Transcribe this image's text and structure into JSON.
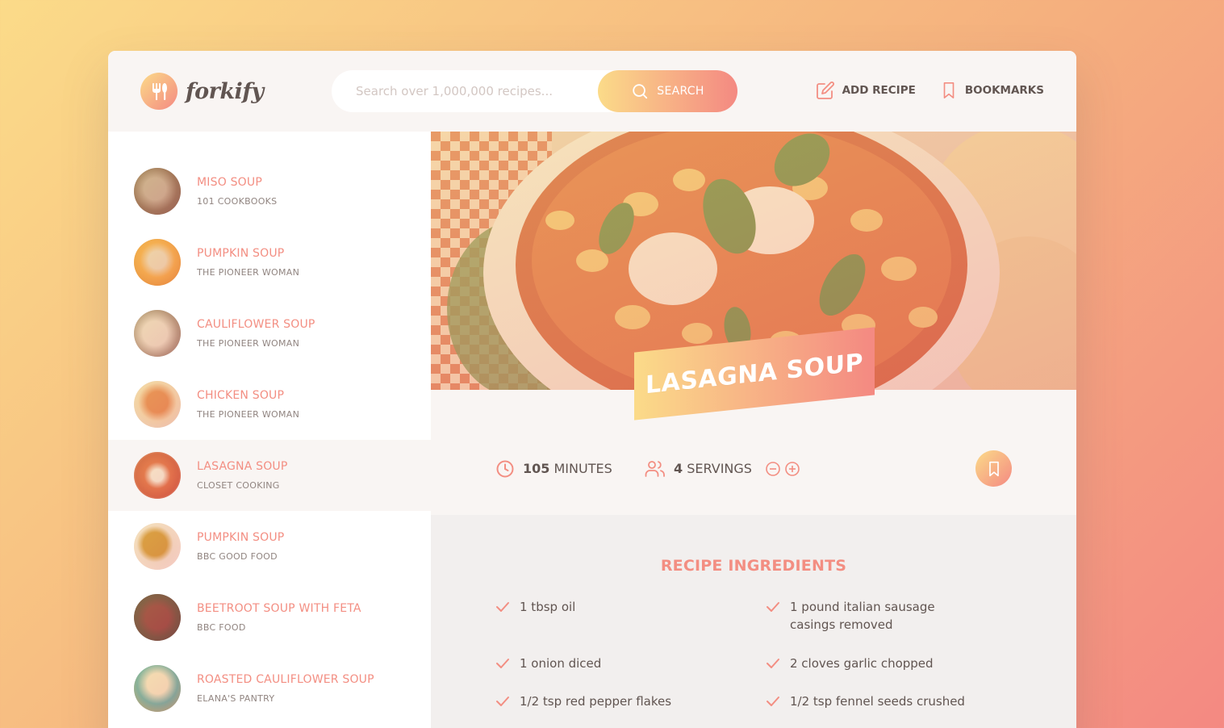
{
  "header": {
    "logo_text": "forkify",
    "search_placeholder": "Search over 1,000,000 recipes...",
    "search_button": "SEARCH",
    "add_recipe": "ADD RECIPE",
    "bookmarks": "BOOKMARKS"
  },
  "results": [
    {
      "title": "MISO SOUP",
      "publisher": "101 COOKBOOKS"
    },
    {
      "title": "PUMPKIN SOUP",
      "publisher": "THE PIONEER WOMAN"
    },
    {
      "title": "CAULIFLOWER SOUP",
      "publisher": "THE PIONEER WOMAN"
    },
    {
      "title": "CHICKEN SOUP",
      "publisher": "THE PIONEER WOMAN"
    },
    {
      "title": "LASAGNA SOUP",
      "publisher": "CLOSET COOKING"
    },
    {
      "title": "PUMPKIN SOUP",
      "publisher": "BBC GOOD FOOD"
    },
    {
      "title": "BEETROOT SOUP WITH FETA",
      "publisher": "BBC FOOD"
    },
    {
      "title": "ROASTED CAULIFLOWER SOUP",
      "publisher": "ELANA'S PANTRY"
    }
  ],
  "recipe": {
    "title": "LASAGNA SOUP",
    "minutes": "105",
    "minutes_label": "MINUTES",
    "servings": "4",
    "servings_label": "SERVINGS",
    "ingredients_heading": "RECIPE INGREDIENTS",
    "ingredients": [
      "1 tbsp oil",
      "1 pound italian sausage casings removed",
      "1 onion diced",
      "2 cloves garlic chopped",
      "1/2 tsp red pepper flakes",
      "1/2 tsp fennel seeds crushed"
    ]
  },
  "colors": {
    "accent_start": "#fbdb89",
    "accent_end": "#f48982",
    "title_text": "#f38e82",
    "body_text": "#615551",
    "panel_bg": "#f9f5f3"
  }
}
